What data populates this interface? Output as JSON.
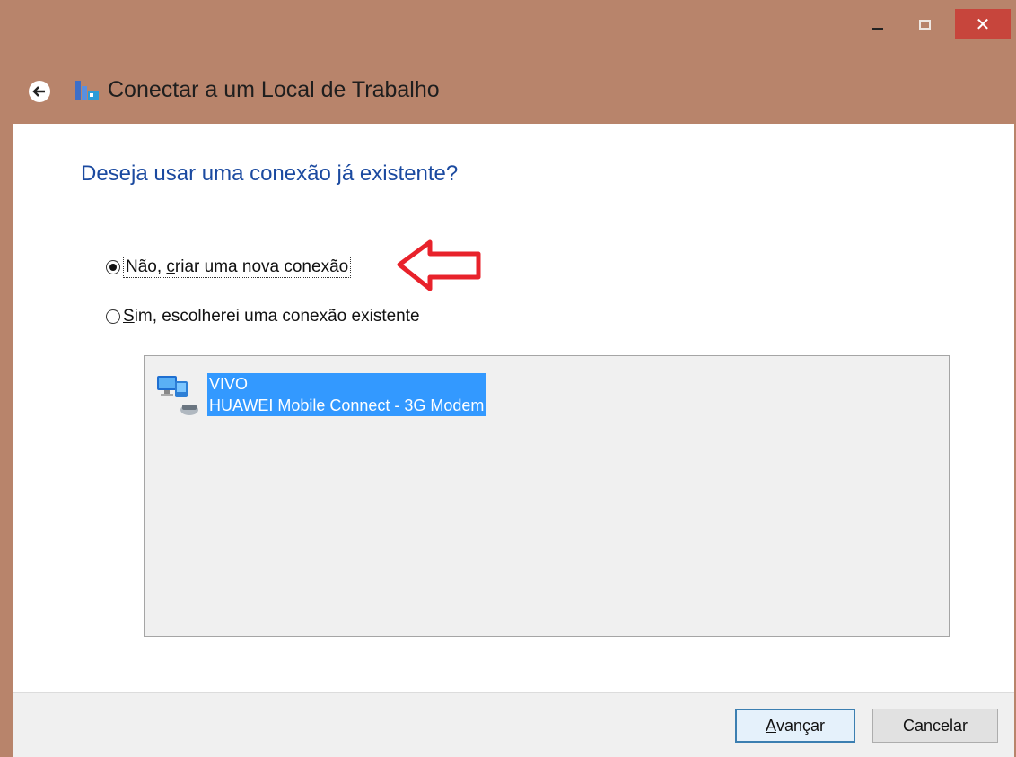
{
  "window": {
    "title": "Conectar a um Local de Trabalho",
    "controls": {
      "minimize": "_",
      "maximize": "□",
      "close": "✕"
    }
  },
  "main": {
    "question": "Deseja usar uma conexão já existente?",
    "options": [
      {
        "prefix": "Não, ",
        "accel": "c",
        "suffix": "riar uma nova conexão",
        "checked": true
      },
      {
        "prefix": "",
        "accel": "S",
        "suffix": "im, escolherei uma conexão existente",
        "checked": false
      }
    ],
    "connections": [
      {
        "name": "VIVO",
        "device": "HUAWEI Mobile Connect - 3G Modem",
        "selected": true
      }
    ]
  },
  "footer": {
    "next": {
      "accel": "A",
      "rest": "vançar"
    },
    "cancel": "Cancelar"
  },
  "colors": {
    "accent": "#3399ff",
    "question": "#1b4aa0",
    "titlebar": "#b8846b",
    "close": "#c7453c",
    "annotation_arrow": "#e8222b"
  },
  "icons": [
    "back-arrow-icon",
    "network-app-icon",
    "network-modem-icon",
    "red-arrow-annotation"
  ]
}
